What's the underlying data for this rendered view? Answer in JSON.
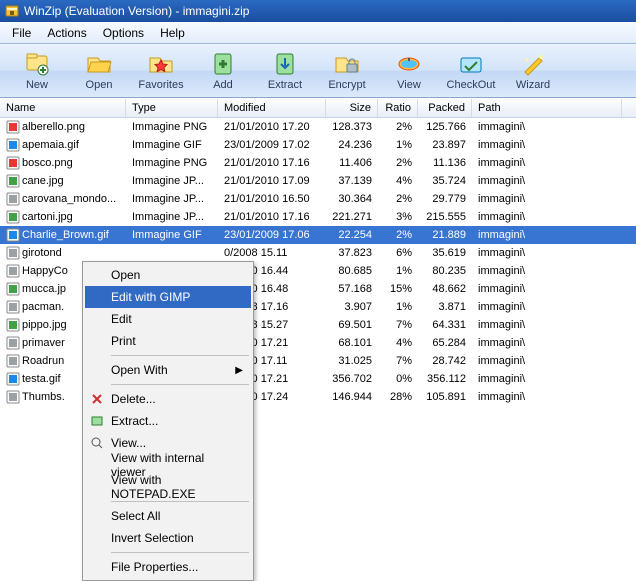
{
  "window": {
    "title": "WinZip (Evaluation Version) - immagini.zip"
  },
  "menubar": [
    "File",
    "Actions",
    "Options",
    "Help"
  ],
  "toolbar": [
    {
      "label": "New",
      "icon": "new"
    },
    {
      "label": "Open",
      "icon": "open"
    },
    {
      "label": "Favorites",
      "icon": "fav"
    },
    {
      "label": "Add",
      "icon": "add"
    },
    {
      "label": "Extract",
      "icon": "extract"
    },
    {
      "label": "Encrypt",
      "icon": "encrypt"
    },
    {
      "label": "View",
      "icon": "view"
    },
    {
      "label": "CheckOut",
      "icon": "checkout"
    },
    {
      "label": "Wizard",
      "icon": "wizard"
    }
  ],
  "headers": [
    "Name",
    "Type",
    "Modified",
    "Size",
    "Ratio",
    "Packed",
    "Path"
  ],
  "rows": [
    {
      "sel": false,
      "name": "alberello.png",
      "type": "Immagine PNG",
      "mod": "21/01/2010 17.20",
      "size": "128.373",
      "ratio": "2%",
      "packed": "125.766",
      "path": "immagini\\"
    },
    {
      "sel": false,
      "name": "apemaia.gif",
      "type": "Immagine GIF",
      "mod": "23/01/2009 17.02",
      "size": "24.236",
      "ratio": "1%",
      "packed": "23.897",
      "path": "immagini\\"
    },
    {
      "sel": false,
      "name": "bosco.png",
      "type": "Immagine PNG",
      "mod": "21/01/2010 17.16",
      "size": "11.406",
      "ratio": "2%",
      "packed": "11.136",
      "path": "immagini\\"
    },
    {
      "sel": false,
      "name": "cane.jpg",
      "type": "Immagine JP...",
      "mod": "21/01/2010 17.09",
      "size": "37.139",
      "ratio": "4%",
      "packed": "35.724",
      "path": "immagini\\"
    },
    {
      "sel": false,
      "name": "carovana_mondo...",
      "type": "Immagine JP...",
      "mod": "21/01/2010 16.50",
      "size": "30.364",
      "ratio": "2%",
      "packed": "29.779",
      "path": "immagini\\"
    },
    {
      "sel": false,
      "name": "cartoni.jpg",
      "type": "Immagine JP...",
      "mod": "21/01/2010 17.16",
      "size": "221.271",
      "ratio": "3%",
      "packed": "215.555",
      "path": "immagini\\"
    },
    {
      "sel": true,
      "name": "Charlie_Brown.gif",
      "type": "Immagine GIF",
      "mod": "23/01/2009 17.06",
      "size": "22.254",
      "ratio": "2%",
      "packed": "21.889",
      "path": "immagini\\"
    },
    {
      "sel": false,
      "name": "girotond",
      "type": "",
      "mod": "0/2008 15.11",
      "size": "37.823",
      "ratio": "6%",
      "packed": "35.619",
      "path": "immagini\\"
    },
    {
      "sel": false,
      "name": "HappyCo",
      "type": "",
      "mod": "1/2010 16.44",
      "size": "80.685",
      "ratio": "1%",
      "packed": "80.235",
      "path": "immagini\\"
    },
    {
      "sel": false,
      "name": "mucca.jp",
      "type": "",
      "mod": "1/2010 16.48",
      "size": "57.168",
      "ratio": "15%",
      "packed": "48.662",
      "path": "immagini\\"
    },
    {
      "sel": false,
      "name": "pacman.",
      "type": "",
      "mod": "1/2008 17.16",
      "size": "3.907",
      "ratio": "1%",
      "packed": "3.871",
      "path": "immagini\\"
    },
    {
      "sel": false,
      "name": "pippo.jpg",
      "type": "",
      "mod": "0/2008 15.27",
      "size": "69.501",
      "ratio": "7%",
      "packed": "64.331",
      "path": "immagini\\"
    },
    {
      "sel": false,
      "name": "primaver",
      "type": "",
      "mod": "1/2010 17.21",
      "size": "68.101",
      "ratio": "4%",
      "packed": "65.284",
      "path": "immagini\\"
    },
    {
      "sel": false,
      "name": "Roadrun",
      "type": "",
      "mod": "1/2010 17.11",
      "size": "31.025",
      "ratio": "7%",
      "packed": "28.742",
      "path": "immagini\\"
    },
    {
      "sel": false,
      "name": "testa.gif",
      "type": "",
      "mod": "1/2010 17.21",
      "size": "356.702",
      "ratio": "0%",
      "packed": "356.112",
      "path": "immagini\\"
    },
    {
      "sel": false,
      "name": "Thumbs.",
      "type": "",
      "mod": "1/2010 17.24",
      "size": "146.944",
      "ratio": "28%",
      "packed": "105.891",
      "path": "immagini\\"
    }
  ],
  "contextMenu": [
    {
      "kind": "item",
      "label": "Open"
    },
    {
      "kind": "item",
      "label": "Edit with GIMP",
      "sel": true
    },
    {
      "kind": "item",
      "label": "Edit"
    },
    {
      "kind": "item",
      "label": "Print"
    },
    {
      "kind": "sep"
    },
    {
      "kind": "item",
      "label": "Open With",
      "submenu": true
    },
    {
      "kind": "sep"
    },
    {
      "kind": "item",
      "label": "Delete...",
      "icon": "x"
    },
    {
      "kind": "item",
      "label": "Extract...",
      "icon": "ext"
    },
    {
      "kind": "item",
      "label": "View...",
      "icon": "view"
    },
    {
      "kind": "item",
      "label": "View with internal viewer"
    },
    {
      "kind": "item",
      "label": "View with NOTEPAD.EXE"
    },
    {
      "kind": "sep"
    },
    {
      "kind": "item",
      "label": "Select All"
    },
    {
      "kind": "item",
      "label": "Invert Selection"
    },
    {
      "kind": "sep"
    },
    {
      "kind": "item",
      "label": "File Properties..."
    }
  ]
}
